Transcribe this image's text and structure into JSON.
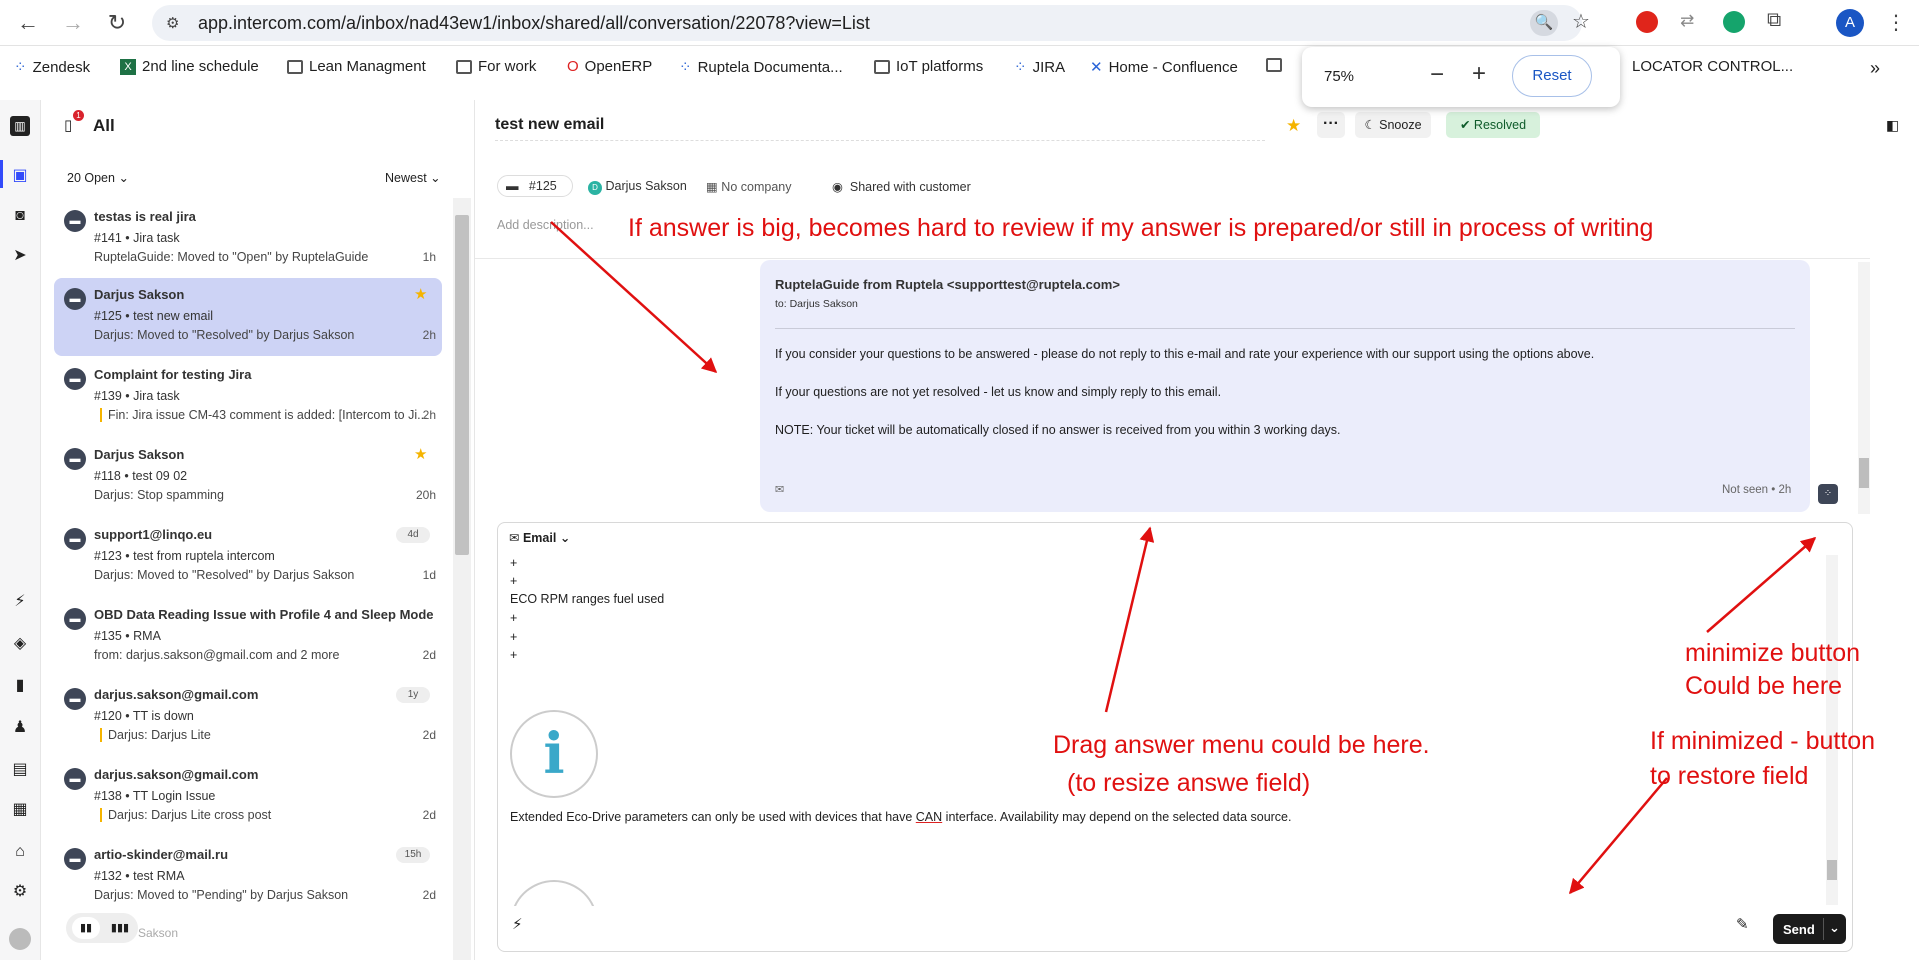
{
  "browser": {
    "url": "app.intercom.com/a/inbox/nad43ew1/inbox/shared/all/conversation/22078?view=List",
    "avatar_letter": "A",
    "bookmarks": [
      "Zendesk",
      "2nd line schedule",
      "Lean Managment",
      "For work",
      "OpenERP",
      "Ruptela Documenta...",
      "IoT platforms",
      "JIRA",
      "Home - Confluence",
      "LOCATOR CONTROL..."
    ],
    "overflow": "»"
  },
  "zoom": {
    "level": "75%",
    "minus": "−",
    "plus": "+",
    "reset": "Reset"
  },
  "sidebar": {
    "title": "All",
    "badge": "1",
    "filter": "20 Open",
    "sort": "Newest",
    "conversations": [
      {
        "name": "testas is real jira",
        "line2": "#141 • Jira task",
        "line3": "RuptelaGuide: Moved to \"Open\" by RuptelaGuide",
        "time": "1h"
      },
      {
        "name": "Darjus Sakson",
        "line2": "#125 • test new email",
        "line3": "Darjus: Moved to \"Resolved\" by Darjus Sakson",
        "time": "2h"
      },
      {
        "name": "Complaint for testing Jira",
        "line2": "#139 • Jira task",
        "line3": "Fin: Jira issue CM-43 comment is added: [Intercom to Ji...",
        "time": "2h"
      },
      {
        "name": "Darjus Sakson",
        "line2": "#118 • test 09 02",
        "line3": "Darjus: Stop spamming",
        "time": "20h"
      },
      {
        "name": "support1@linqo.eu",
        "line2": "#123 • test from ruptela intercom",
        "line3": "Darjus: Moved to \"Resolved\" by Darjus Sakson",
        "time": "1d",
        "tag": "4d"
      },
      {
        "name": "OBD Data Reading Issue with Profile 4 and Sleep Mode",
        "line2": "#135 • RMA",
        "line3": "from: darjus.sakson@gmail.com and 2 more",
        "time": "2d"
      },
      {
        "name": "darjus.sakson@gmail.com",
        "line2": "#120 • TT is down",
        "line3": "Darjus: Darjus Lite",
        "time": "2d",
        "tag": "1y"
      },
      {
        "name": "darjus.sakson@gmail.com",
        "line2": "#138 • TT Login Issue",
        "line3": "Darjus: Darjus Lite cross post",
        "time": "2d"
      },
      {
        "name": "artio-skinder@mail.ru",
        "line2": "#132 • test RMA",
        "line3": "Darjus: Moved to \"Pending\" by Darjus Sakson",
        "time": "2d",
        "tag": "15h"
      }
    ],
    "footer_partial": "Sakson"
  },
  "conversation": {
    "title": "test new email",
    "snooze": "Snooze",
    "resolved": "Resolved",
    "ticket_id": "#125",
    "contact": "Darjus Sakson",
    "contact_initial": "D",
    "company": "No company",
    "shared": "Shared with customer",
    "add_description": "Add description..."
  },
  "message": {
    "from": "RuptelaGuide from Ruptela <supporttest@ruptela.com>",
    "to": "to: Darjus Sakson",
    "p1": "If you consider your questions to be answered - please do not reply to this e-mail and rate your experience with our support using the options above.",
    "p2": "If your questions are not yet resolved - let us know and simply reply to this email.",
    "p3": "NOTE: Your ticket will be automatically closed if no answer is received from you within 3 working days.",
    "status": "Not seen • 2h"
  },
  "composer": {
    "channel": "Email",
    "lines": [
      "+",
      "+",
      "ECO RPM ranges fuel used",
      "+",
      "+",
      "+"
    ],
    "paragraph_before": "Extended Eco-Drive parameters can only be used with devices that have ",
    "can": "CAN",
    "paragraph_after": " interface. Availability may depend on the selected data source.",
    "send": "Send"
  },
  "annotations": {
    "a1": "If answer is big, becomes hard to review if my answer is prepared/or still in process of writing",
    "a2": "minimize button",
    "a3": "Could be here",
    "a4": "Drag answer menu could be here.",
    "a5": "(to resize answe field)",
    "a6": "If minimized - button",
    "a7": "to restore field"
  },
  "colors": {
    "accent": "#334bfa",
    "selected": "#cdd3f5",
    "resolved_bg": "#d7f1dc",
    "annotation": "#e01010",
    "message_bg": "#ebedfb"
  }
}
